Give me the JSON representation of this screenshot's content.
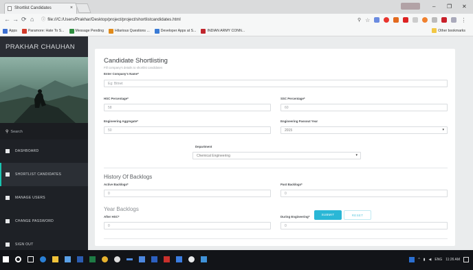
{
  "browser": {
    "tab_title": "Shortlist Candidates",
    "tab_close": "×",
    "profile_label": "Tab profile",
    "win_min": "–",
    "win_max": "❐",
    "win_close": "✕",
    "address": "file:///C:/Users/Prakhar/Desktop/project/project/shortlistcandidates.html",
    "bookmarks": [
      {
        "label": "Apps",
        "color": "#3c6fd1"
      },
      {
        "label": "Paramore: Hate To S...",
        "color": "#d23a2a"
      },
      {
        "label": "Message Pending",
        "color": "#2f8d3f"
      },
      {
        "label": "Hilarious Questions ...",
        "color": "#e08a1a"
      },
      {
        "label": "Developer Apps at S...",
        "color": "#3a7bd5"
      },
      {
        "label": "INDIAN ARMY CONN...",
        "color": "#c0262d"
      }
    ],
    "other_bookmarks": "Other bookmarks"
  },
  "sidebar": {
    "brand": "PRAKHAR CHAUHAN",
    "search_placeholder": "Search",
    "items": [
      {
        "label": "DASHBOARD",
        "icon": "home-icon",
        "active": false
      },
      {
        "label": "SHORTLIST CANDIDATES",
        "icon": "list-icon",
        "active": true
      },
      {
        "label": "MANAGE USERS",
        "icon": "users-icon",
        "active": false
      },
      {
        "label": "CHANGE PASSWORD",
        "icon": "lock-icon",
        "active": false
      },
      {
        "label": "SIGN OUT",
        "icon": "logout-icon",
        "active": false
      }
    ]
  },
  "form": {
    "title": "Candidate Shortlisting",
    "subtitle": "Fill company's details to shortlist candidates",
    "company_label": "Enter Company's Name*",
    "company_placeholder": "Eg: Bitnet",
    "hsc_label": "HSC Percentage*",
    "hsc_value": "58",
    "ssc_label": "SSC Percentage*",
    "ssc_value": "60",
    "eng_agg_label": "Engineering Aggregate*",
    "eng_agg_value": "50",
    "passout_label": "Engineering Passout Year",
    "passout_value": "2015",
    "dept_label": "Department",
    "dept_value": "Chemical Engineering",
    "backlogs_title": "History Of Backlogs",
    "active_label": "Active Backlogs*",
    "active_value": "0",
    "past_label": "Past Backlogs*",
    "past_value": "0",
    "year_title": "Year Backlogs",
    "after_hsc_label": "After HSC*",
    "after_hsc_value": "0",
    "during_eng_label": "During Engineering*",
    "during_eng_value": "0",
    "submit": "SUBMIT",
    "reset": "RESET"
  },
  "tray": {
    "lang": "ENG",
    "time": "11:26 AM"
  }
}
